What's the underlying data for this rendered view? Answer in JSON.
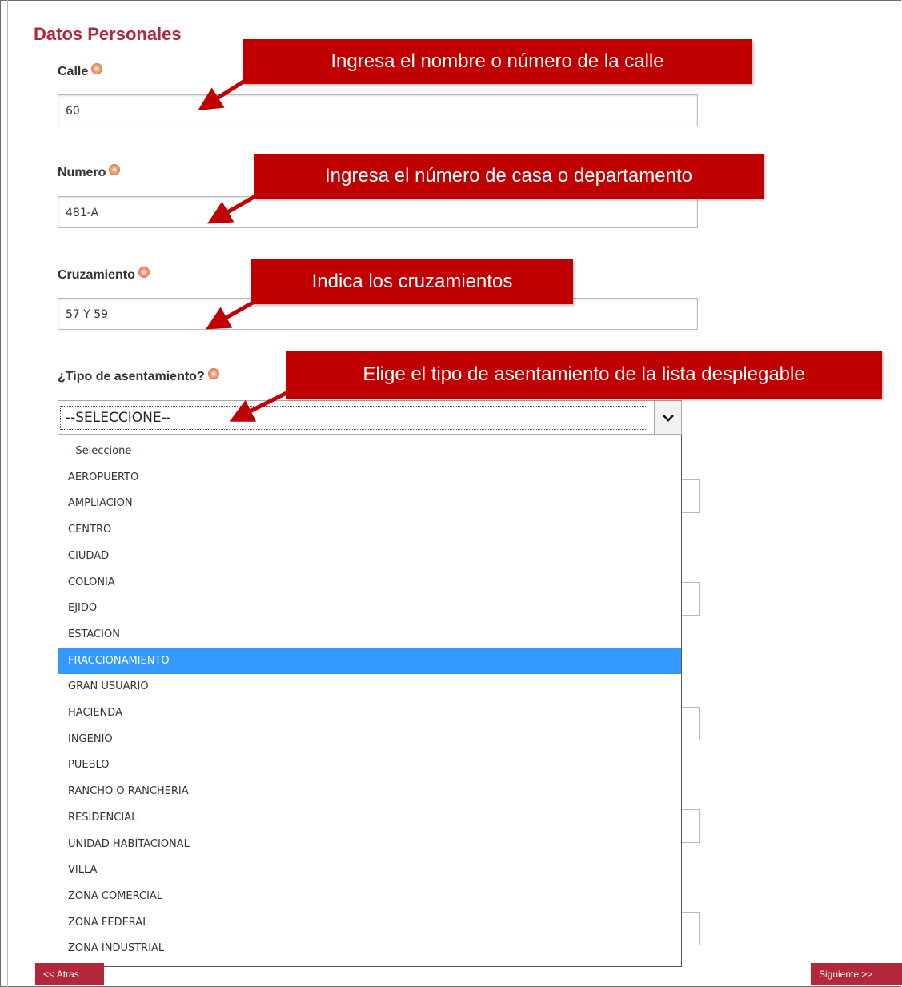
{
  "form": {
    "title": "Datos Personales",
    "calle": {
      "label": "Calle",
      "value": "60"
    },
    "numero": {
      "label": "Numero",
      "value": "481-A"
    },
    "cruzamiento": {
      "label": "Cruzamiento",
      "value": "57 Y 59"
    },
    "tipo": {
      "label": "¿Tipo de asentamiento?",
      "selected": "--SELECCIONE--",
      "options": [
        "--Seleccione--",
        "AEROPUERTO",
        "AMPLIACION",
        "CENTRO",
        "CIUDAD",
        "COLONIA",
        "EJIDO",
        "ESTACION",
        "FRACCIONAMIENTO",
        "GRAN USUARIO",
        "HACIENDA",
        "INGENIO",
        "PUEBLO",
        "RANCHO O RANCHERIA",
        "RESIDENCIAL",
        "UNIDAD HABITACIONAL",
        "VILLA",
        "ZONA COMERCIAL",
        "ZONA FEDERAL",
        "ZONA INDUSTRIAL"
      ],
      "highlighted": "FRACCIONAMIENTO"
    }
  },
  "callouts": {
    "calle": "Ingresa el nombre o número de la calle",
    "numero": "Ingresa el número de casa o departamento",
    "cruzamiento": "Indica los cruzamientos",
    "tipo": "Elige el tipo de asentamiento de la lista desplegable"
  },
  "nav": {
    "back": "<< Atras",
    "next": "Siguiente >>"
  },
  "colors": {
    "title": "#b3273b",
    "callout": "#c00000",
    "highlight": "#3399ff",
    "button": "#b3273b"
  }
}
